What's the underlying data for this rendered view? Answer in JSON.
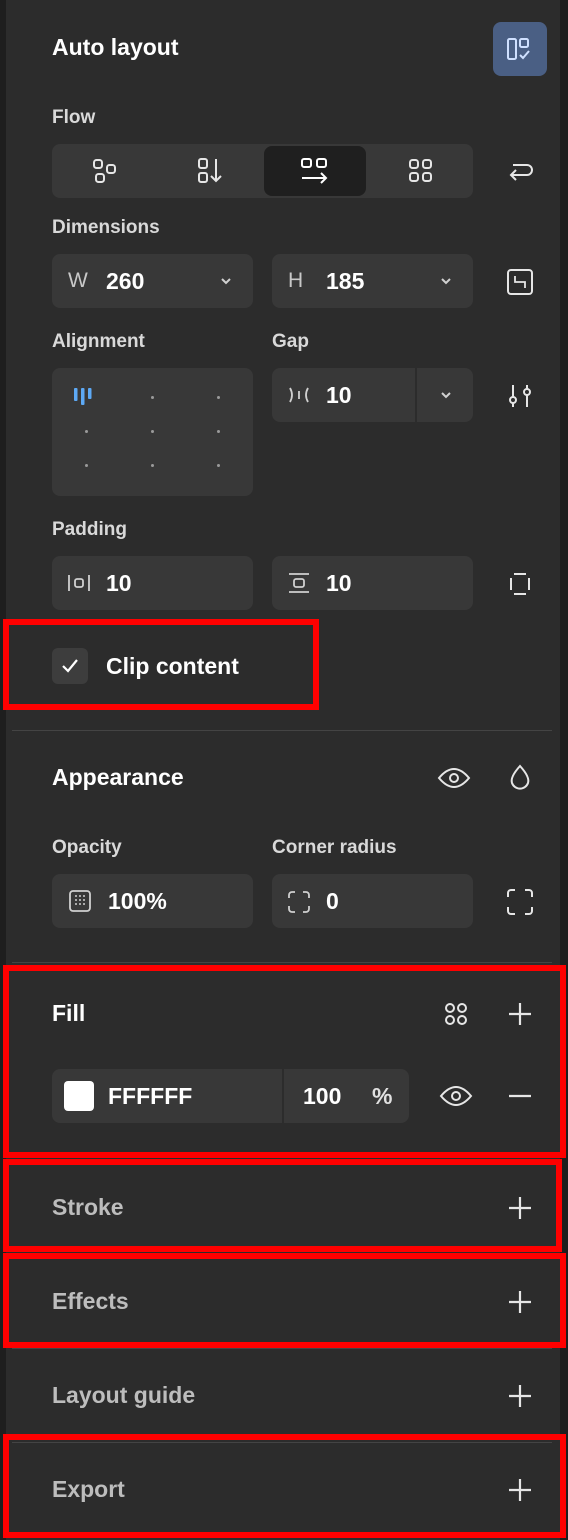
{
  "auto_layout": {
    "title": "Auto layout",
    "flow_label": "Flow",
    "dimensions_label": "Dimensions",
    "width_prefix": "W",
    "width_value": "260",
    "height_prefix": "H",
    "height_value": "185",
    "alignment_label": "Alignment",
    "gap_label": "Gap",
    "gap_value": "10",
    "padding_label": "Padding",
    "padding_horizontal": "10",
    "padding_vertical": "10",
    "clip_content_label": "Clip content",
    "clip_content_checked": true
  },
  "appearance": {
    "title": "Appearance",
    "opacity_label": "Opacity",
    "opacity_value": "100%",
    "corner_radius_label": "Corner radius",
    "corner_radius_value": "0"
  },
  "fill": {
    "title": "Fill",
    "color_hex": "FFFFFF",
    "opacity": "100",
    "percent_sign": "%",
    "swatch_color": "#FFFFFF"
  },
  "sections": {
    "stroke": "Stroke",
    "effects": "Effects",
    "layout_guide": "Layout guide",
    "export": "Export"
  },
  "colors": {
    "panel_bg": "#2C2C2C",
    "field_bg": "#383838",
    "active_icon_bg": "#4A5F84",
    "highlight": "#FF0000",
    "alignment_active": "#5DA9F5"
  }
}
